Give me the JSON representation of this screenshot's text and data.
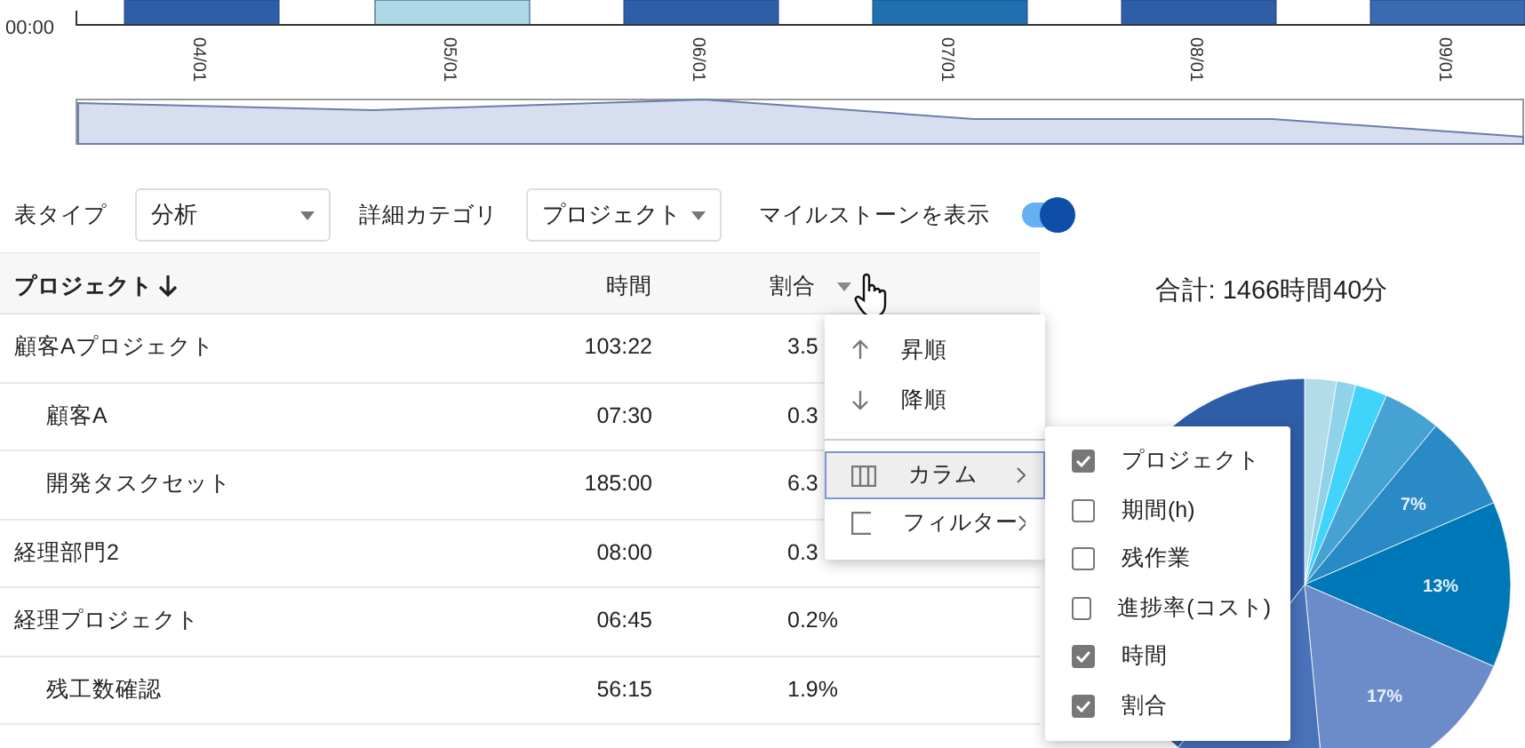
{
  "timeline": {
    "y_label": "00:00",
    "x_labels": [
      "04/01",
      "05/01",
      "06/01",
      "07/01",
      "08/01",
      "09/01"
    ]
  },
  "controls": [
    {
      "label": "表タイプ",
      "value": "分析"
    },
    {
      "label": "詳細カテゴリ",
      "value": "プロジェクト"
    }
  ],
  "milestone_toggle": {
    "label": "マイルストーンを表示",
    "on": true
  },
  "table": {
    "columns": [
      {
        "label": "プロジェクト",
        "sorted": true
      },
      {
        "label": "時間",
        "sorted": false
      },
      {
        "label": "割合",
        "sorted": false
      }
    ],
    "rows": [
      {
        "name": "顧客Aプロジェクト",
        "time": "103:22",
        "share": "3.5",
        "children": [
          {
            "name": "顧客A",
            "time": "07:30",
            "share": "0.3"
          },
          {
            "name": "開発タスクセット",
            "time": "185:00",
            "share": "6.3"
          }
        ]
      },
      {
        "name": "経理部門2",
        "time": "08:00",
        "share": "0.3"
      },
      {
        "name": "経理プロジェクト",
        "time": "06:45",
        "share": "0.2%",
        "children": [
          {
            "name": "残工数確認",
            "time": "56:15",
            "share": "1.9%"
          }
        ]
      }
    ]
  },
  "column_menu": {
    "items": [
      {
        "kind": "sort-asc",
        "label": "昇順",
        "selected": false
      },
      {
        "kind": "sort-desc",
        "label": "降順",
        "selected": false
      },
      {
        "kind": "columns",
        "label": "カラム",
        "selected": true
      },
      {
        "kind": "filter",
        "label": "フィルター",
        "selected": false
      }
    ]
  },
  "column_submenu": {
    "items": [
      {
        "label": "プロジェクト",
        "checked": true
      },
      {
        "label": "期間(h)",
        "checked": false
      },
      {
        "label": "残作業",
        "checked": false
      },
      {
        "label": "進捗率(コスト)",
        "checked": false
      },
      {
        "label": "時間",
        "checked": true
      },
      {
        "label": "割合",
        "checked": true
      }
    ]
  },
  "pie": {
    "title": "合計: 1466時間40分",
    "slice_labels": [
      "7%",
      "13%",
      "17%"
    ]
  }
}
